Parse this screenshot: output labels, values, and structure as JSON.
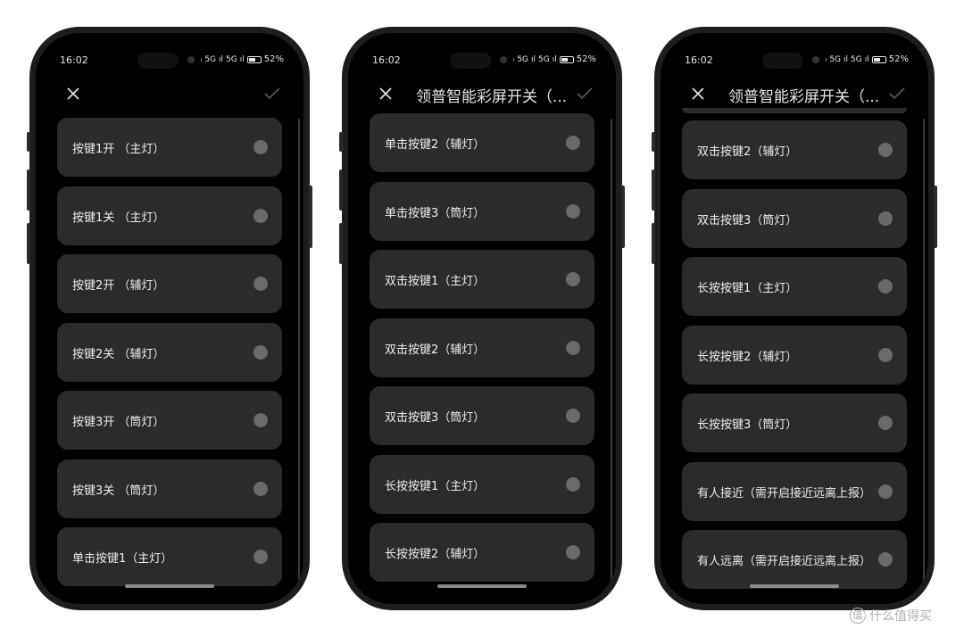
{
  "phones": [
    {
      "time": "16:02",
      "battery": "52%",
      "title": "",
      "items": [
        "按键1开 （主灯）",
        "按键1关 （主灯）",
        "按键2开 （辅灯）",
        "按键2关 （辅灯）",
        "按键3开 （筒灯）",
        "按键3关 （筒灯）",
        "单击按键1（主灯）"
      ]
    },
    {
      "time": "16:02",
      "battery": "52%",
      "title": "领普智能彩屏开关（...",
      "items": [
        "单击按键2（辅灯）",
        "单击按键3（筒灯）",
        "双击按键1（主灯）",
        "双击按键2（辅灯）",
        "双击按键3（筒灯）",
        "长按按键1（主灯）",
        "长按按键2（辅灯）"
      ]
    },
    {
      "time": "16:02",
      "battery": "52%",
      "title": "领普智能彩屏开关（...",
      "items": [
        "双击按键2（辅灯）",
        "双击按键3（筒灯）",
        "长按按键1（主灯）",
        "长按按键2（辅灯）",
        "长按按键3（筒灯）",
        "有人接近（需开启接近远离上报）",
        "有人远离（需开启接近远离上报）"
      ]
    }
  ],
  "status_signal": "5G",
  "watermark": "什么值得买",
  "watermark_icon": "值"
}
